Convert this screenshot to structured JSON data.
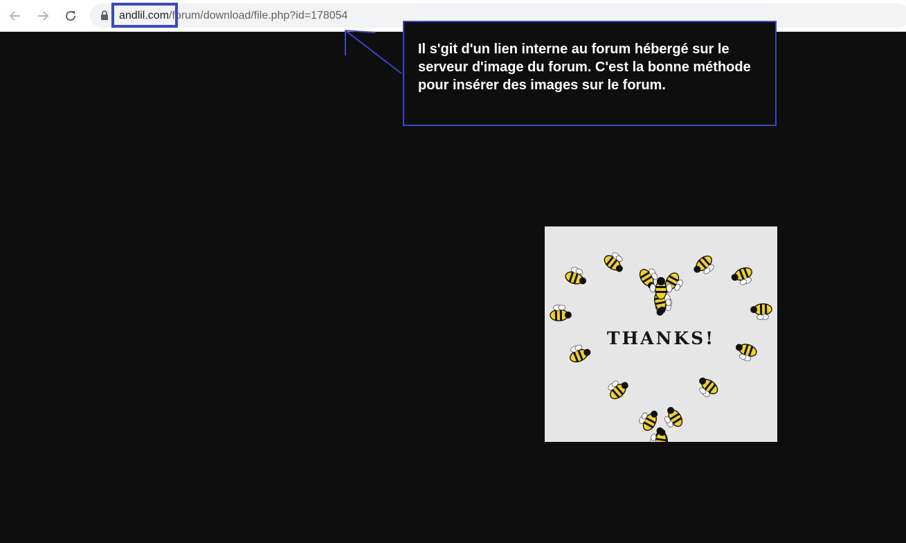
{
  "browser": {
    "back_icon": "arrow-left-icon",
    "forward_icon": "arrow-right-icon",
    "reload_icon": "reload-icon",
    "lock_icon": "lock-icon",
    "url_host": "andlil.com",
    "url_path": "/forum/download/file.php?id=178054"
  },
  "annotation": {
    "text": "Il s'git d'un lien interne au forum hébergé sur le serveur d'image du forum. C'est la bonne méthode pour insérer des images sur le forum.",
    "color": "#3c46c8"
  },
  "image": {
    "caption": "THANKS!",
    "description_icon": "bee-heart-image"
  }
}
